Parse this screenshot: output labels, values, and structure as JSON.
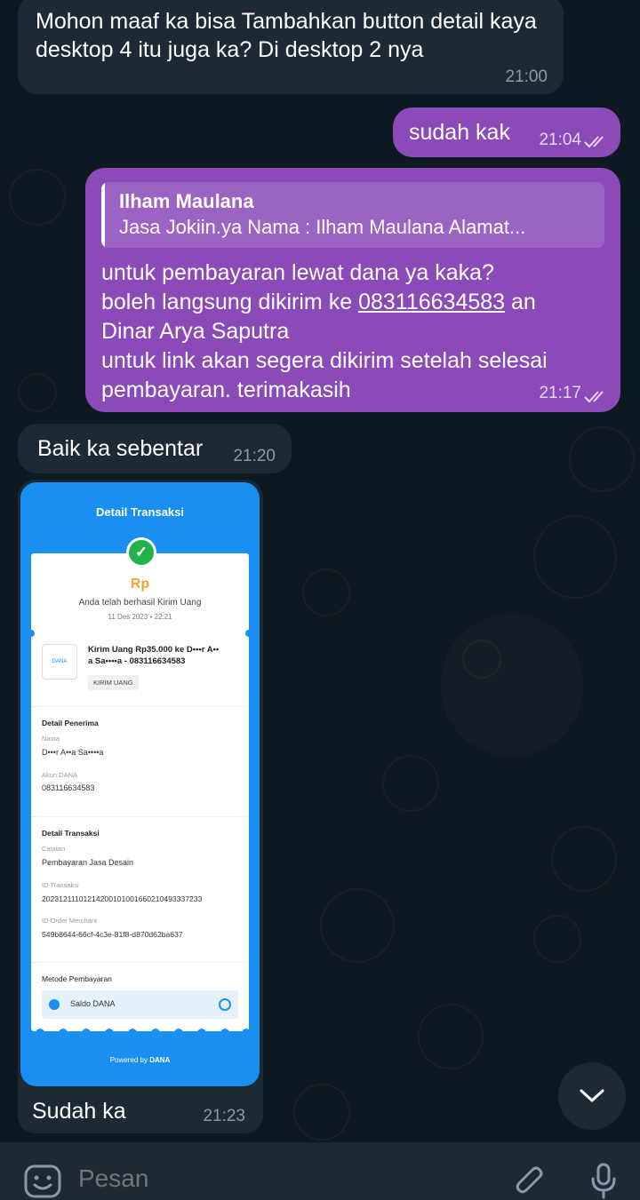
{
  "messages": [
    {
      "id": "m1",
      "direction": "incoming",
      "text": "Mohon maaf ka bisa Tambahkan button detail kaya desktop 4 itu juga ka? Di desktop 2 nya",
      "time": "21:00"
    },
    {
      "id": "m2",
      "direction": "outgoing",
      "text": "sudah kak",
      "time": "21:04",
      "status": "read"
    },
    {
      "id": "m3",
      "direction": "outgoing",
      "reply_to": {
        "name": "Ilham Maulana",
        "snippet": "Jasa Jokiin.ya  Nama : Ilham Maulana Alamat..."
      },
      "line1": "untuk pembayaran lewat dana ya kaka?",
      "line2_prefix": "boleh langsung dikirim ke ",
      "phone": "083116634583",
      "line2_suffix": " an",
      "line3": "Dinar Arya Saputra",
      "line4": "untuk link akan segera dikirim setelah selesai",
      "line5": "pembayaran. terimakasih",
      "time": "21:17",
      "status": "read"
    },
    {
      "id": "m4",
      "direction": "incoming",
      "text": "Baik ka sebentar",
      "time": "21:20"
    },
    {
      "id": "m5",
      "direction": "incoming",
      "caption": "Sudah ka",
      "time": "21:23",
      "receipt": {
        "title": "Detail Transaksi",
        "amount": "Rp",
        "success_text": "Anda telah berhasil Kirim Uang",
        "datetime": "11 Des 2023 • 22:21",
        "logo_text": "DANA",
        "transfer_line1": "Kirim Uang Rp35.000 ke D•••r A••",
        "transfer_line2": "a Sa••••a - 083116634583",
        "tag": "KIRIM UANG",
        "recipient_header": "Detail Penerima",
        "name_label": "Nama",
        "name_value": "D•••r A••a Sa••••a",
        "account_label": "Akun DANA",
        "account_value": "083116634583",
        "transaction_header": "Detail Transaksi",
        "note_label": "Catatan",
        "note_value": "Pembayaran Jasa Desain",
        "txid_label": "ID Transaksi",
        "txid_value": "20231211101214200101001660210493337233",
        "order_label": "ID Order Merchant",
        "order_value": "549b8644-66cf-4c3e-81f8-d870d62ba637",
        "method_header": "Metode Pembayaran",
        "method_value": "Saldo DANA",
        "powered_by": "Powered by",
        "powered_brand": "DANA"
      }
    }
  ],
  "composer": {
    "placeholder": "Pesan"
  },
  "icons": {
    "emoji": "emoji-icon",
    "attach": "paperclip-icon",
    "mic": "microphone-icon",
    "scroll_down": "chevron-down-icon",
    "read_status": "double-check-icon"
  },
  "colors": {
    "background": "#0f1921",
    "incoming_bubble": "#1d2a35",
    "outgoing_bubble": "#8a4bb8",
    "dana_blue": "#1a8ff2"
  }
}
